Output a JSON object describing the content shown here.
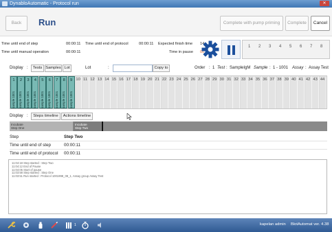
{
  "window": {
    "title": "DynabloAutomatic - Protocol run"
  },
  "toolbar": {
    "back_label": "Back",
    "run_title": "Run",
    "complete_pump_label": "Complete with pump priming",
    "complete_label": "Complete",
    "cancel_label": "Cancel"
  },
  "info": {
    "time_end_step_label": "Time until end of step",
    "time_end_step_value": "00:00:11",
    "time_end_protocol_label": "Time until end of protocol",
    "time_end_protocol_value": "00:00:11",
    "expected_finish_label": "Expected finish time",
    "expected_finish_value": "14",
    "manual_op_label": "Time until manual operation",
    "manual_op_value": "00:00:11",
    "time_in_pause_label": "Time in pause",
    "time_in_pause_value": "00"
  },
  "step_numbers": [
    "1",
    "2",
    "3",
    "4",
    "5",
    "6",
    "7",
    "8"
  ],
  "display_bar": {
    "display_label": "Display",
    "colon": ":",
    "tests_label": "Tests",
    "samples_label": "Samples",
    "lot_btn_label": "Lot",
    "lot_label": "Lot",
    "lot_value": "",
    "copy_to_label": "Copy to",
    "order_label": "Order",
    "order_value": "1",
    "test_label": "Test",
    "test_value": "SampleIgM",
    "sample_label": "Sample",
    "sample_value": "1 - 1001",
    "assay_label": "Assay",
    "assay_value": "Assay Test"
  },
  "strips": {
    "active_text": "sample 1001",
    "numbers": [
      "1",
      "2",
      "3",
      "4",
      "5",
      "6",
      "7",
      "8",
      "9",
      "10",
      "11",
      "12",
      "13",
      "14",
      "15",
      "16",
      "17",
      "18",
      "19",
      "20",
      "21",
      "22",
      "23",
      "24",
      "25",
      "26",
      "27",
      "28",
      "29",
      "30",
      "31",
      "32",
      "33",
      "34",
      "35",
      "36",
      "37",
      "38",
      "39",
      "40",
      "41",
      "42",
      "43",
      "44"
    ],
    "active_count": 9
  },
  "timeline_bar": {
    "display_label": "Display",
    "colon": ":",
    "steps_timeline_label": "Steps timeline",
    "actions_timeline_label": "Actions timeline",
    "seg1_line1": "Incubate",
    "seg1_line2": "Step One",
    "seg2_line1": "Incubate",
    "seg2_line2": "Step Two"
  },
  "details": {
    "step_label": "Step",
    "step_value": "Step Two",
    "time_end_step_label": "Time until end of step",
    "time_end_step_value": "00:00:11",
    "time_end_protocol_label": "Time until end of protocol",
    "time_end_protocol_value": "00:00:11"
  },
  "log_lines": [
    "11:04:18  Step started : Step Two",
    "11:04:12  End of Pause",
    "11:04:05  Start of pause",
    "11:03:58  Step started : Step One",
    "11:03:51  Run started : Protocol 1001998_08_1, Assay group Assay Test"
  ],
  "status": {
    "user": "kapelan admin",
    "version": "BlotAutomat ver. 4.38",
    "badge": "1"
  },
  "colors": {
    "accent_blue": "#1b4f9c",
    "strip_active": "#78b9b4",
    "warning_orange": "#e06a2c"
  }
}
